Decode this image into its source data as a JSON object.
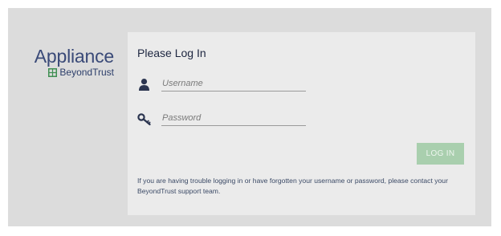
{
  "brand": {
    "name": "Appliance",
    "sub_name": "BeyondTrust",
    "logo_icon": "beyondtrust-logo",
    "colors": {
      "name": "#3a4a78",
      "logo_green": "#3f8f52"
    }
  },
  "login": {
    "title": "Please Log In",
    "username": {
      "icon": "user-icon",
      "placeholder": "Username",
      "value": ""
    },
    "password": {
      "icon": "key-icon",
      "placeholder": "Password",
      "value": ""
    },
    "submit_label": "LOG IN",
    "submit_color": "#a9cfae",
    "help_text": "If you are having trouble logging in or have forgotten your username or password, please contact your BeyondTrust support team."
  }
}
